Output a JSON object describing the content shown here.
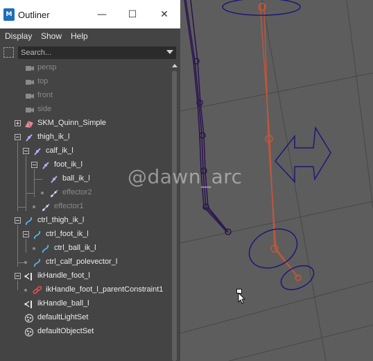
{
  "window": {
    "title": "Outliner",
    "app_icon_text": "M",
    "minimize_glyph": "—",
    "maximize_glyph": "☐",
    "close_glyph": "✕"
  },
  "menu": {
    "display": "Display",
    "show": "Show",
    "help": "Help"
  },
  "search": {
    "placeholder": "Search..."
  },
  "tree": [
    {
      "label": "persp",
      "icon": "camera-icon",
      "dim": true
    },
    {
      "label": "top",
      "icon": "camera-icon",
      "dim": true
    },
    {
      "label": "front",
      "icon": "camera-icon",
      "dim": true
    },
    {
      "label": "side",
      "icon": "camera-icon",
      "dim": true
    },
    {
      "label": "SKM_Quinn_Simple",
      "icon": "mesh-icon",
      "dim": false
    },
    {
      "label": "thigh_ik_l",
      "icon": "joint-icon",
      "dim": false
    },
    {
      "label": "calf_ik_l",
      "icon": "joint-icon",
      "dim": false
    },
    {
      "label": "foot_ik_l",
      "icon": "joint-icon",
      "dim": false
    },
    {
      "label": "ball_ik_l",
      "icon": "joint-icon",
      "dim": false
    },
    {
      "label": "effector2",
      "icon": "effector-icon",
      "dim": true
    },
    {
      "label": "effector1",
      "icon": "effector-icon",
      "dim": true
    },
    {
      "label": "ctrl_thigh_ik_l",
      "icon": "curve-icon",
      "dim": false
    },
    {
      "label": "ctrl_foot_ik_l",
      "icon": "curve-icon",
      "dim": false
    },
    {
      "label": "ctrl_ball_ik_l",
      "icon": "curve-icon",
      "dim": false
    },
    {
      "label": "ctrl_calf_polevector_l",
      "icon": "curve-icon",
      "dim": false
    },
    {
      "label": "ikHandle_foot_l",
      "icon": "ik-handle-icon",
      "dim": false
    },
    {
      "label": "ikHandle_foot_l_parentConstraint1",
      "icon": "constraint-icon",
      "dim": false
    },
    {
      "label": "ikHandle_ball_l",
      "icon": "ik-handle-icon",
      "dim": false
    },
    {
      "label": "defaultLightSet",
      "icon": "set-icon",
      "dim": false
    },
    {
      "label": "defaultObjectSet",
      "icon": "set-icon",
      "dim": false
    }
  ],
  "watermark": "@dawn_arc",
  "colors": {
    "viewport_bg": "#5d5d5d",
    "grid": "#454545",
    "joint_chain": "#2c1650",
    "ik_chain": "#c0573a",
    "control_curve": "#1d1878",
    "joint_icon": "#b7a6f5",
    "curve_icon": "#5ab4e6",
    "constraint_icon": "#e05050"
  }
}
